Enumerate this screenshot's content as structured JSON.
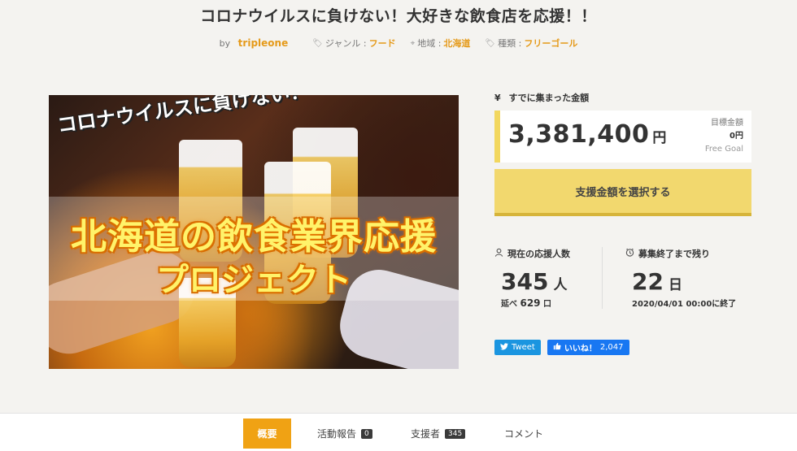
{
  "project": {
    "title": "コロナウイルスに負けない！大好きな飲食店を応援！！",
    "by_label": "by",
    "author": "tripleone",
    "genre_label": "ジャンル :",
    "genre": "フード",
    "region_label": "地域 :",
    "region": "北海道",
    "type_label": "種類 :",
    "type": "フリーゴール"
  },
  "hero": {
    "tagline": "コロナウイルスに負けない！",
    "headline_1": "北海道の飲食業界応援",
    "headline_2": "プロジェクト"
  },
  "funding": {
    "raised_label": "すでに集まった金額",
    "currency_icon": "¥",
    "raised_amount": "3,381,400",
    "raised_unit": "円",
    "goal_label": "目標金額",
    "goal_amount": "0円",
    "goal_type": "Free Goal",
    "select_button": "支援金額を選択する"
  },
  "stats": {
    "supporters_label": "現在の応援人数",
    "supporters_count": "345",
    "supporters_unit": "人",
    "total_label": "延べ",
    "total_count": "629",
    "total_unit": "口",
    "remaining_label": "募集終了まで残り",
    "remaining_days": "22",
    "remaining_unit": "日",
    "end_date": "2020/04/01 00:00に終了"
  },
  "social": {
    "tweet_label": "Tweet",
    "like_label": "いいね！",
    "like_count": "2,047"
  },
  "tabs": [
    {
      "label": "概要",
      "active": true
    },
    {
      "label": "活動報告",
      "count": "0"
    },
    {
      "label": "支援者",
      "count": "345"
    },
    {
      "label": "コメント"
    }
  ],
  "colors": {
    "accent": "#e59a1a",
    "button": "#f2d86e",
    "tab_active": "#f0a214",
    "twitter": "#1b95e0",
    "facebook": "#1877f2"
  }
}
